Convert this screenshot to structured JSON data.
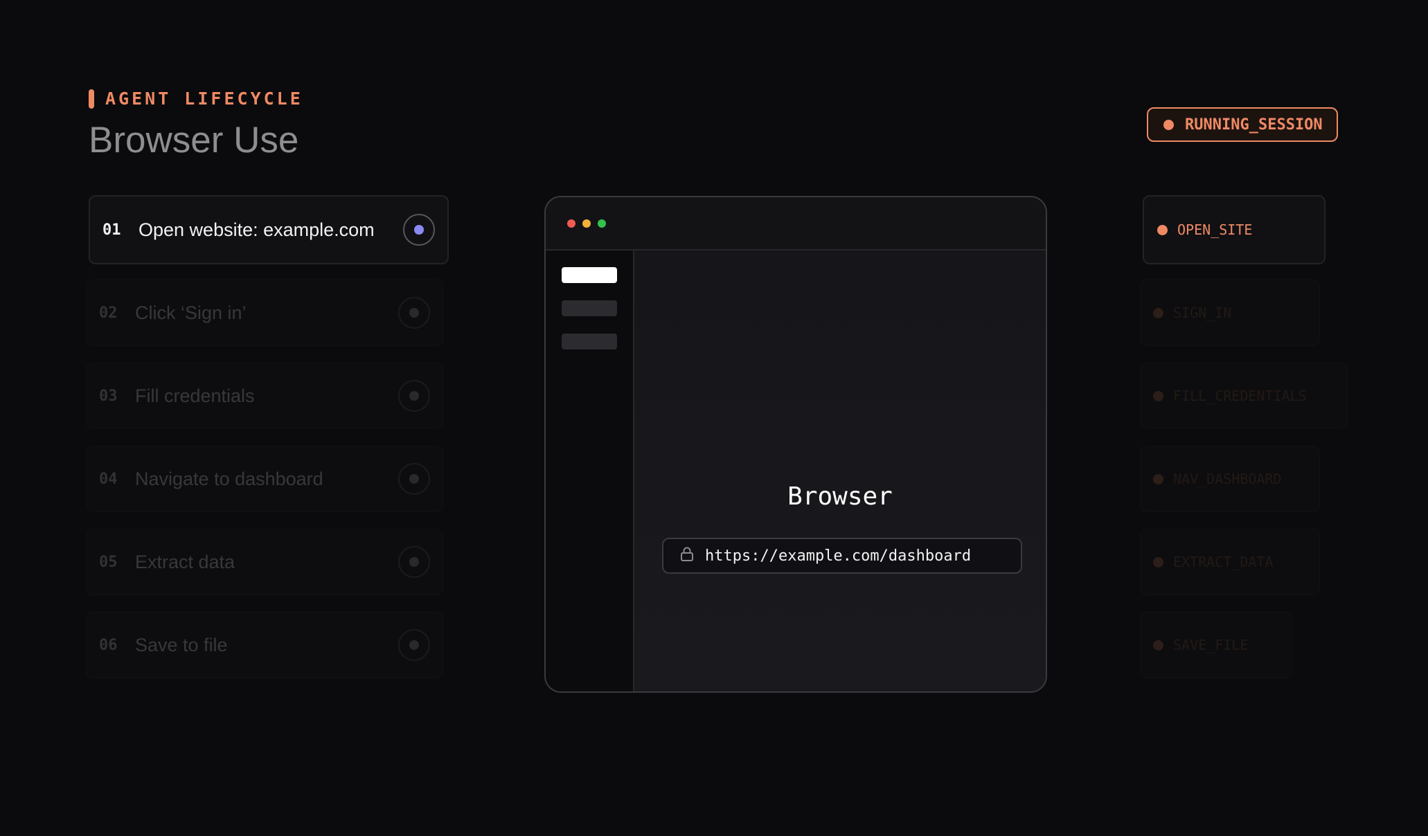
{
  "header": {
    "eyebrow": "AGENT LIFECYCLE",
    "title": "Browser Use",
    "session_badge": "RUNNING_SESSION"
  },
  "steps": [
    {
      "num": "01",
      "label": "Open website: example.com",
      "active": true
    },
    {
      "num": "02",
      "label": "Click ‘Sign in’",
      "active": false
    },
    {
      "num": "03",
      "label": "Fill credentials",
      "active": false
    },
    {
      "num": "04",
      "label": "Navigate to dashboard",
      "active": false
    },
    {
      "num": "05",
      "label": "Extract data",
      "active": false
    },
    {
      "num": "06",
      "label": "Save to file",
      "active": false
    }
  ],
  "browser": {
    "title": "Browser",
    "url": "https://example.com/dashboard",
    "traffic_light_colors": [
      "#ef5b52",
      "#f2b23a",
      "#33c24d"
    ]
  },
  "actions": [
    {
      "label": "OPEN_SITE",
      "active": true
    },
    {
      "label": "SIGN_IN",
      "active": false
    },
    {
      "label": "FILL_CREDENTIALS",
      "active": false
    },
    {
      "label": "NAV_DASHBOARD",
      "active": false
    },
    {
      "label": "EXTRACT_DATA",
      "active": false
    },
    {
      "label": "SAVE_FILE",
      "active": false
    }
  ],
  "colors": {
    "accent": "#f08a64",
    "active_status": "#8a8af2",
    "background": "#0b0b0d"
  }
}
